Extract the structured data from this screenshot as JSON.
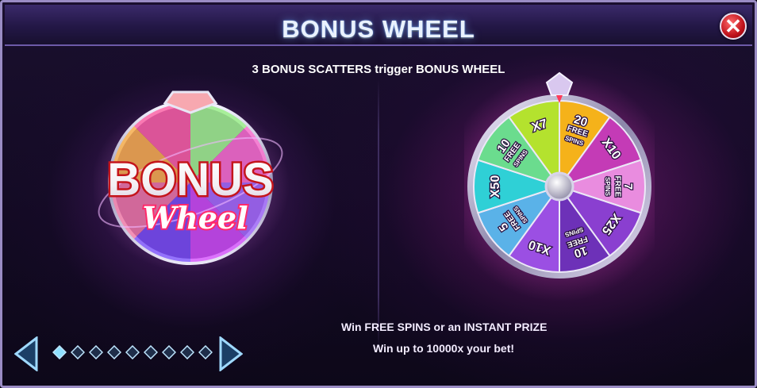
{
  "header": {
    "title": "BONUS WHEEL",
    "close_symbol": "✕"
  },
  "subtitle": "3 BONUS SCATTERS trigger BONUS WHEEL",
  "logo": {
    "line1": "BONUS",
    "line2": "Wheel"
  },
  "wheel": {
    "segments": [
      {
        "top": "20",
        "mid": "FREE",
        "bot": "SPINS",
        "color": "#f5b21a"
      },
      {
        "top": "X10",
        "mid": "",
        "bot": "",
        "color": "#c43bb6"
      },
      {
        "top": "7",
        "mid": "FREE",
        "bot": "SPINS",
        "color": "#e98cdf"
      },
      {
        "top": "X25",
        "mid": "",
        "bot": "",
        "color": "#8a3fd0"
      },
      {
        "top": "10",
        "mid": "FREE",
        "bot": "SPINS",
        "color": "#6d31b8"
      },
      {
        "top": "X10",
        "mid": "",
        "bot": "",
        "color": "#9b4fe3"
      },
      {
        "top": "5",
        "mid": "FREE",
        "bot": "SPINS",
        "color": "#5ab2e8"
      },
      {
        "top": "X50",
        "mid": "",
        "bot": "",
        "color": "#2fd0d6"
      },
      {
        "top": "10",
        "mid": "FREE",
        "bot": "SPINS",
        "color": "#6bdc8e"
      },
      {
        "top": "X7",
        "mid": "",
        "bot": "",
        "color": "#b4e22e"
      }
    ]
  },
  "info": {
    "line1": "Win FREE SPINS or an INSTANT PRIZE",
    "line2": "Win up to 10000x your bet!"
  },
  "pagination": {
    "total_pages": 9,
    "current_page": 1
  },
  "colors": {
    "accent": "#8fe0ff",
    "close": "#c0121b"
  }
}
